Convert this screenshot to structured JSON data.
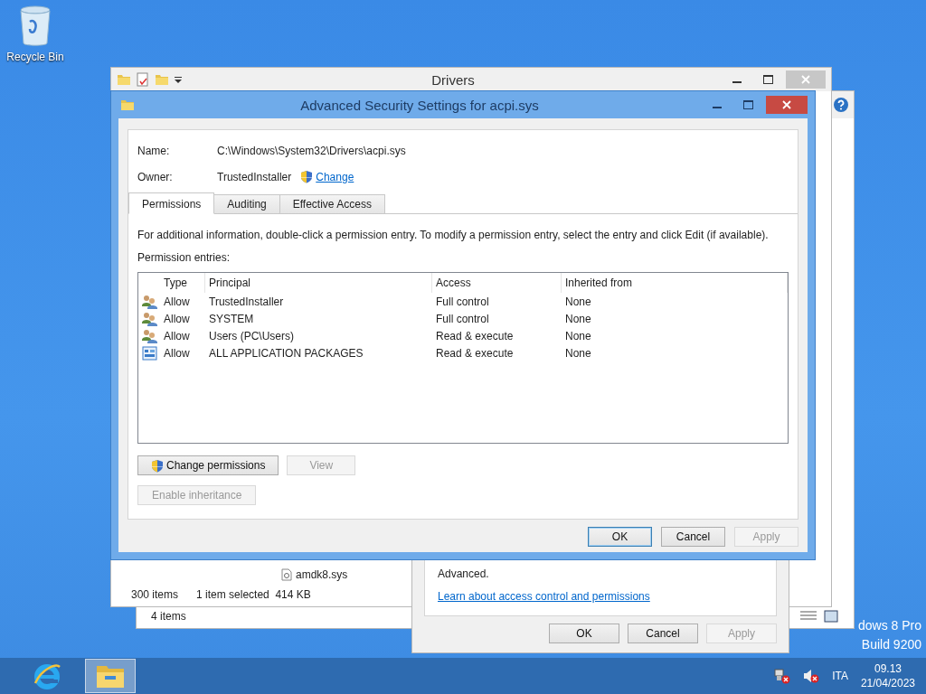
{
  "desktop": {
    "icons": [
      {
        "label": "Recycle Bin"
      }
    ],
    "watermark": [
      "dows 8 Pro",
      "Build 9200"
    ]
  },
  "back_window": {
    "status_bar": {
      "items": "4 items"
    }
  },
  "explorer": {
    "title": "Drivers",
    "file": "amdk8.sys",
    "status_bar": {
      "count": "300 items",
      "selection": "1 item selected  414 KB"
    }
  },
  "properties_dialog": {
    "text": "Advanced.",
    "link": "Learn about access control and permissions",
    "buttons": [
      {
        "label": "OK",
        "disabled": false
      },
      {
        "label": "Cancel",
        "disabled": false
      },
      {
        "label": "Apply",
        "disabled": true
      }
    ]
  },
  "dialog": {
    "title": "Advanced Security Settings for acpi.sys",
    "name_label": "Name:",
    "name": "C:\\Windows\\System32\\Drivers\\acpi.sys",
    "owner_label": "Owner:",
    "owner": "TrustedInstaller",
    "change_link": "Change",
    "tabs": [
      {
        "label": "Permissions",
        "selected": true
      },
      {
        "label": "Auditing",
        "selected": false
      },
      {
        "label": "Effective Access",
        "selected": false
      }
    ],
    "info": "For additional information, double-click a permission entry. To modify a permission entry, select the entry and click Edit (if available).",
    "entries_label": "Permission entries:",
    "columns": [
      "Type",
      "Principal",
      "Access",
      "Inherited from"
    ],
    "rows": [
      {
        "kind": "user",
        "type": "Allow",
        "principal": "TrustedInstaller",
        "access": "Full control",
        "inherited": "None"
      },
      {
        "kind": "user",
        "type": "Allow",
        "principal": "SYSTEM",
        "access": "Full control",
        "inherited": "None"
      },
      {
        "kind": "user",
        "type": "Allow",
        "principal": "Users (PC\\Users)",
        "access": "Read & execute",
        "inherited": "None"
      },
      {
        "kind": "package",
        "type": "Allow",
        "principal": "ALL APPLICATION PACKAGES",
        "access": "Read & execute",
        "inherited": "None"
      }
    ],
    "actions": [
      {
        "label": "Change permissions",
        "shield": true,
        "disabled": false
      },
      {
        "label": "View",
        "shield": false,
        "disabled": true
      }
    ],
    "inheritance_button": {
      "label": "Enable inheritance",
      "disabled": true
    },
    "buttons": [
      {
        "label": "OK",
        "default": true,
        "disabled": false
      },
      {
        "label": "Cancel",
        "default": false,
        "disabled": false
      },
      {
        "label": "Apply",
        "default": false,
        "disabled": true
      }
    ]
  },
  "taskbar": {
    "apps": [
      {
        "kind": "browser",
        "selected": false
      },
      {
        "kind": "explorer",
        "selected": true
      }
    ],
    "language": "ITA",
    "time": "09.13",
    "date": "21/04/2023"
  }
}
